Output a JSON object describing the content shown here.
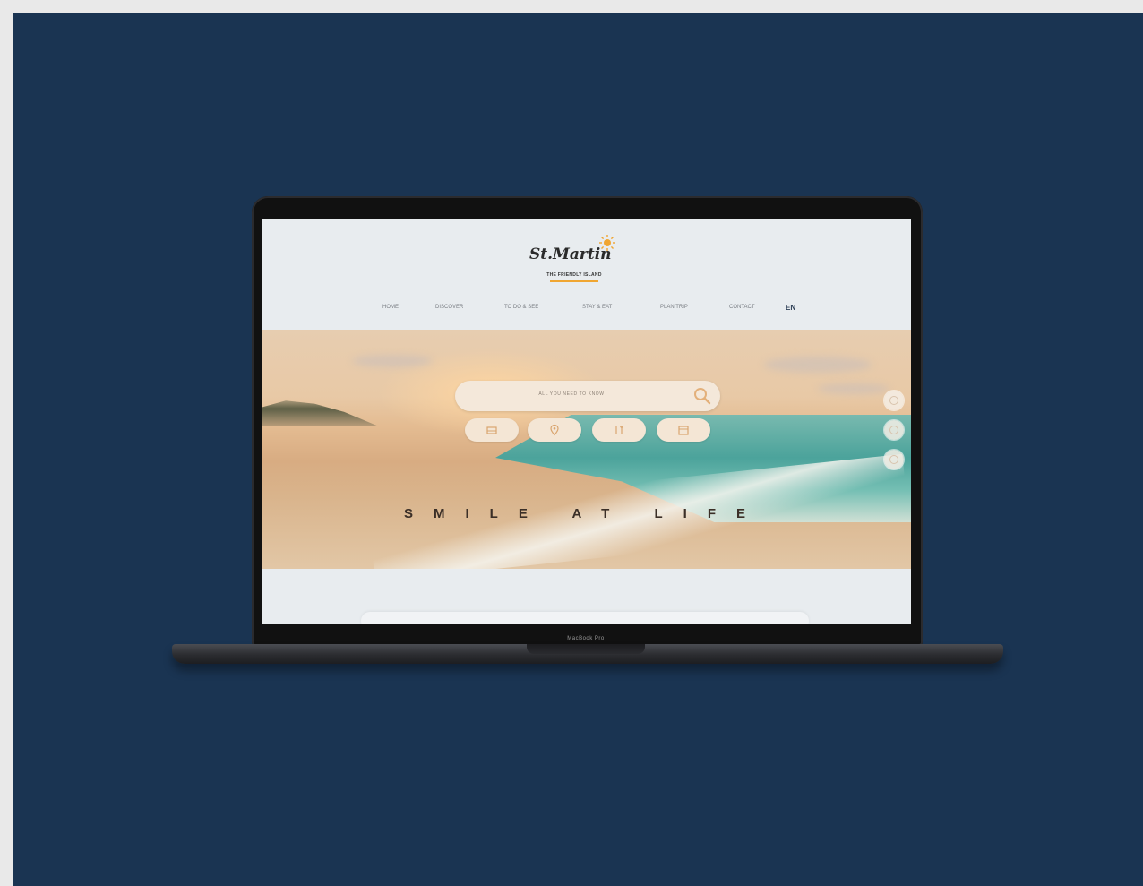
{
  "device": {
    "model_label": "MacBook Pro"
  },
  "site": {
    "logo": {
      "wordmark": "St.Martin",
      "tagline": "THE FRIENDLY ISLAND",
      "accent_color": "#f0a632"
    },
    "nav": {
      "items": [
        "HOME",
        "DISCOVER",
        "TO DO & SEE",
        "STAY & EAT",
        "PLAN TRIP",
        "CONTACT"
      ],
      "language": "EN"
    },
    "hero": {
      "search_placeholder": "ALL YOU NEED TO KNOW",
      "quick_buttons": [
        "hotel-icon",
        "location-icon",
        "dining-icon",
        "calendar-icon"
      ],
      "tagline": "SMILE AT LIFE",
      "side_controls": [
        "share",
        "favorite",
        "info"
      ]
    }
  },
  "colors": {
    "background": "#1a3452",
    "accent": "#f0a632",
    "screen_bg": "#e8ecef"
  }
}
